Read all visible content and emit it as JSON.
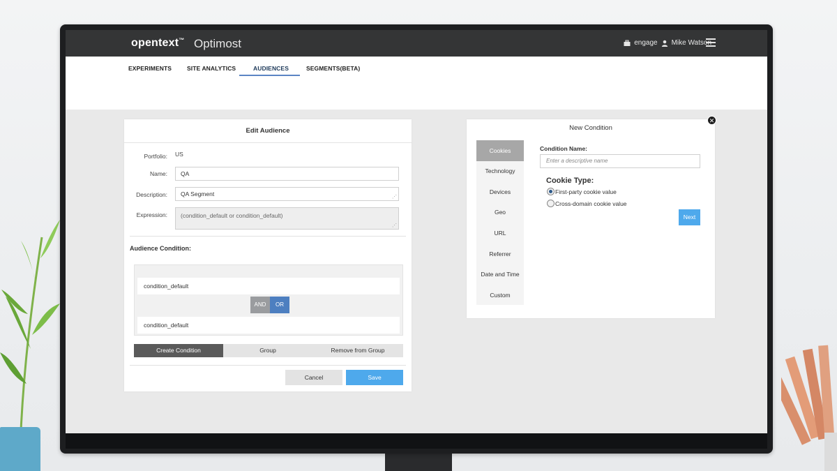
{
  "header": {
    "logo": "opentext",
    "logo_tm": "™",
    "product": "Optimost",
    "workspace": "engage",
    "user": "Mike Watson"
  },
  "nav": {
    "tabs": [
      {
        "label": "EXPERIMENTS"
      },
      {
        "label": "SITE ANALYTICS"
      },
      {
        "label": "AUDIENCES"
      },
      {
        "label": "SEGMENTS(BETA)"
      }
    ],
    "active": "AUDIENCES"
  },
  "edit_audience": {
    "title": "Edit Audience",
    "portfolio_label": "Portfolio:",
    "portfolio_value": "US",
    "name_label": "Name:",
    "name_value": "QA",
    "description_label": "Description:",
    "description_value": "QA Segment",
    "expression_label": "Expression:",
    "expression_value": "(condition_default or condition_default)",
    "audience_condition_label": "Audience Condition:",
    "conditions": [
      "condition_default",
      "condition_default"
    ],
    "logic_and": "AND",
    "logic_or": "OR",
    "logic_selected": "OR",
    "actions": [
      "Create Condition",
      "Group",
      "Remove from Group"
    ],
    "cancel_label": "Cancel",
    "save_label": "Save"
  },
  "new_condition": {
    "title": "New Condition",
    "categories": [
      "Cookies",
      "Technology",
      "Devices",
      "Geo",
      "URL",
      "Referrer",
      "Date and Time",
      "Custom"
    ],
    "active_category": "Cookies",
    "condition_name_label": "Condition Name:",
    "condition_name_placeholder": "Enter a descriptive name",
    "cookie_type_label": "Cookie Type:",
    "cookie_options": [
      "First-party cookie value",
      "Cross-domain cookie value"
    ],
    "cookie_selected": "First-party cookie value",
    "next_label": "Next"
  },
  "colors": {
    "topbar": "#343536",
    "accent_blue": "#4ea9ec",
    "or_blue": "#4d7fc0",
    "nav_underline": "#5b84c4"
  }
}
